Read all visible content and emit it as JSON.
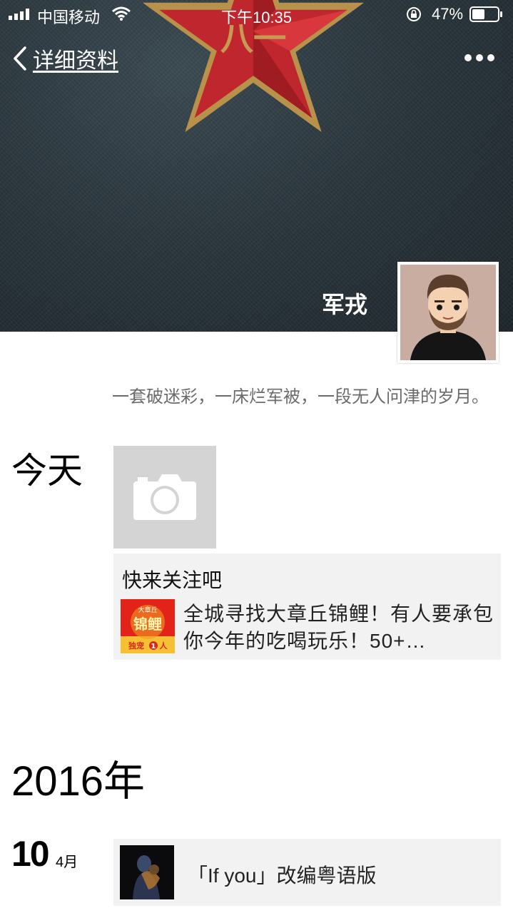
{
  "status_bar": {
    "carrier": "中国移动",
    "time": "下午10:35",
    "battery": "47%"
  },
  "nav": {
    "back_label": "详细资料"
  },
  "profile": {
    "name": "军戎",
    "signature": "一套破迷彩，一床烂军被，一段无人问津的岁月。"
  },
  "moments": {
    "today": {
      "label": "今天",
      "share_title": "快来关注吧",
      "share_desc": "全城寻找大章丘锦鲤！有人要承包你今年的吃喝玩乐！50+…",
      "thumb_top": "大章丘",
      "thumb_main": "锦鲤",
      "thumb_bottom": "独宠",
      "thumb_count": "1",
      "thumb_unit": "人"
    },
    "year": "2016年",
    "entry": {
      "day": "10",
      "month": "4月",
      "title": "「If you」改编粤语版"
    }
  },
  "colors": {
    "cover": "#2a363d",
    "star_red": "#c0262d",
    "star_gold": "#b8914a",
    "card_bg": "#f2f2f3",
    "placeholder": "#d4d4d4"
  },
  "icons": [
    "signal-icon",
    "wifi-icon",
    "rotation-lock-icon",
    "battery-icon",
    "back-chevron-icon",
    "more-icon",
    "camera-icon"
  ]
}
